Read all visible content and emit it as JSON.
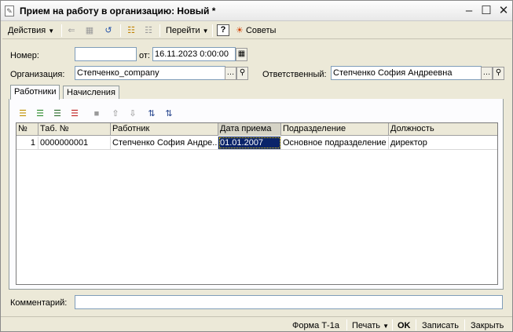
{
  "window": {
    "title": "Прием на работу в организацию: Новый *"
  },
  "toolbar": {
    "actions_label": "Действия",
    "goto_label": "Перейти",
    "help_glyph": "?",
    "tips_label": "Советы"
  },
  "form": {
    "number_label": "Номер:",
    "number_value": "",
    "date_label": "от:",
    "date_value": "16.11.2023  0:00:00",
    "org_label": "Организация:",
    "org_value": "Степченко_company",
    "resp_label": "Ответственный:",
    "resp_value": "Степченко София Андреевна",
    "comment_label": "Комментарий:",
    "comment_value": ""
  },
  "tabs": [
    {
      "label": "Работники",
      "active": true
    },
    {
      "label": "Начисления",
      "active": false
    }
  ],
  "grid": {
    "columns": [
      "№",
      "Таб. №",
      "Работник",
      "Дата приема",
      "Подразделение",
      "Должность"
    ],
    "rows": [
      {
        "num": "1",
        "tab_no": "0000000001",
        "employee": "Степченко София Андре...",
        "date": "01.01.2007",
        "department": "Основное подразделение",
        "position": "директор"
      }
    ]
  },
  "footer": {
    "form_label": "Форма Т-1а",
    "print_label": "Печать",
    "ok_label": "OK",
    "save_label": "Записать",
    "close_label": "Закрыть"
  },
  "icons": {
    "add": "add-row-icon",
    "copy": "copy-row-icon",
    "edit": "edit-row-icon",
    "delete": "delete-row-icon",
    "end_edit": "end-edit-icon",
    "move_up": "move-up-icon",
    "move_down": "move-down-icon",
    "sort_asc": "sort-asc-icon",
    "sort_desc": "sort-desc-icon"
  },
  "colors": {
    "selection": "#0a246a",
    "window_bg": "#ece9d8",
    "field_border": "#7f9db9"
  }
}
